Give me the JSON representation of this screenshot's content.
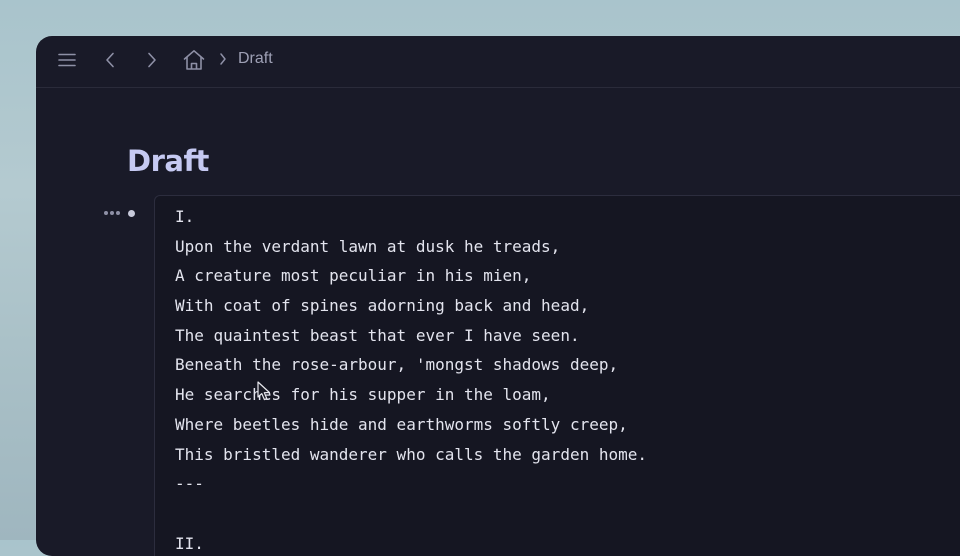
{
  "breadcrumb": {
    "current": "Draft"
  },
  "page": {
    "title": "Draft"
  },
  "editor": {
    "lines": [
      "I.",
      "Upon the verdant lawn at dusk he treads,",
      "A creature most peculiar in his mien,",
      "With coat of spines adorning back and head,",
      "The quaintest beast that ever I have seen.",
      "Beneath the rose-arbour, 'mongst shadows deep,",
      "He searches for his supper in the loam,",
      "Where beetles hide and earthworms softly creep,",
      "This bristled wanderer who calls the garden home.",
      "---",
      "",
      "II."
    ]
  },
  "icons": [
    "menu-icon",
    "chevron-left-icon",
    "chevron-right-icon",
    "home-icon",
    "chevron-right-icon",
    "more-dots-icon",
    "bullet-icon",
    "mouse-pointer-icon"
  ],
  "colors": {
    "window_bg": "#191a28",
    "editor_bg": "#151622",
    "title": "#c5c9f2",
    "text": "#e3e4ee"
  }
}
